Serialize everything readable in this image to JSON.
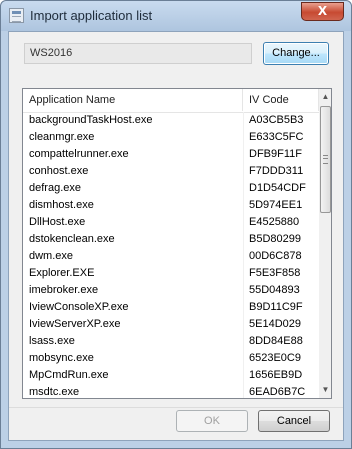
{
  "window": {
    "title": "Import application list",
    "close_glyph": "X"
  },
  "server": {
    "value": "WS2016",
    "change_label": "Change..."
  },
  "list": {
    "columns": [
      "Application Name",
      "IV Code"
    ],
    "rows": [
      [
        "backgroundTaskHost.exe",
        "A03CB5B3"
      ],
      [
        "cleanmgr.exe",
        "E633C5FC"
      ],
      [
        "compattelrunner.exe",
        "DFB9F11F"
      ],
      [
        "conhost.exe",
        "F7DDD311"
      ],
      [
        "defrag.exe",
        "D1D54CDF"
      ],
      [
        "dismhost.exe",
        "5D974EE1"
      ],
      [
        "DllHost.exe",
        "E4525880"
      ],
      [
        "dstokenclean.exe",
        "B5D80299"
      ],
      [
        "dwm.exe",
        "00D6C878"
      ],
      [
        "Explorer.EXE",
        "F5E3F858"
      ],
      [
        "imebroker.exe",
        "55D04893"
      ],
      [
        "IviewConsoleXP.exe",
        "B9D11C9F"
      ],
      [
        "IviewServerXP.exe",
        "5E14D029"
      ],
      [
        "lsass.exe",
        "8DD84E88"
      ],
      [
        "mobsync.exe",
        "6523E0C9"
      ],
      [
        "MpCmdRun.exe",
        "1656EB9D"
      ],
      [
        "msdtc.exe",
        "6EAD6B7C"
      ]
    ]
  },
  "buttons": {
    "ok": "OK",
    "cancel": "Cancel"
  },
  "icons": {
    "app": "app-window-icon",
    "scroll_up": "chevron-up-icon",
    "scroll_down": "chevron-down-icon"
  }
}
